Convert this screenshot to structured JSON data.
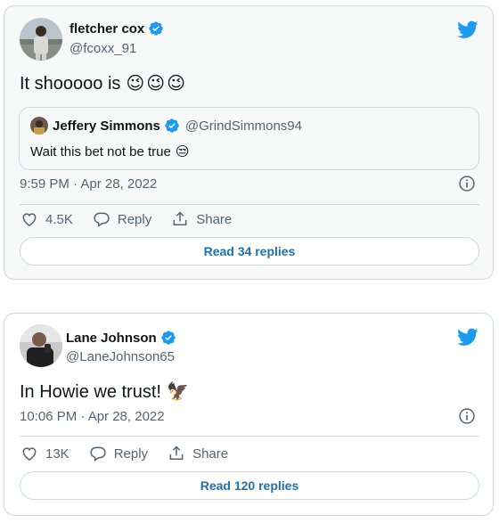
{
  "colors": {
    "twitter_blue": "#1d9bf0",
    "link_blue": "#1d6fb0",
    "secondary_text": "#536471",
    "heart_outline": "#536471"
  },
  "tweets": [
    {
      "display_name": "fletcher cox",
      "handle": "@fcoxx_91",
      "text": "It shooooo is",
      "emojis": [
        "😉",
        "😉",
        "😉"
      ],
      "quote": {
        "display_name": "Jeffery Simmons",
        "handle": "@GrindSimmons94",
        "text": "Wait this bet not be true",
        "emoji": "😒"
      },
      "timestamp": "9:59 PM · Apr 28, 2022",
      "likes": "4.5K",
      "reply_label": "Reply",
      "share_label": "Share",
      "read_replies": "Read 34 replies"
    },
    {
      "display_name": "Lane Johnson",
      "handle": "@LaneJohnson65",
      "text": "In Howie we trust!",
      "emojis": [
        "🦅"
      ],
      "timestamp": "10:06 PM · Apr 28, 2022",
      "likes": "13K",
      "reply_label": "Reply",
      "share_label": "Share",
      "read_replies": "Read 120 replies"
    }
  ]
}
